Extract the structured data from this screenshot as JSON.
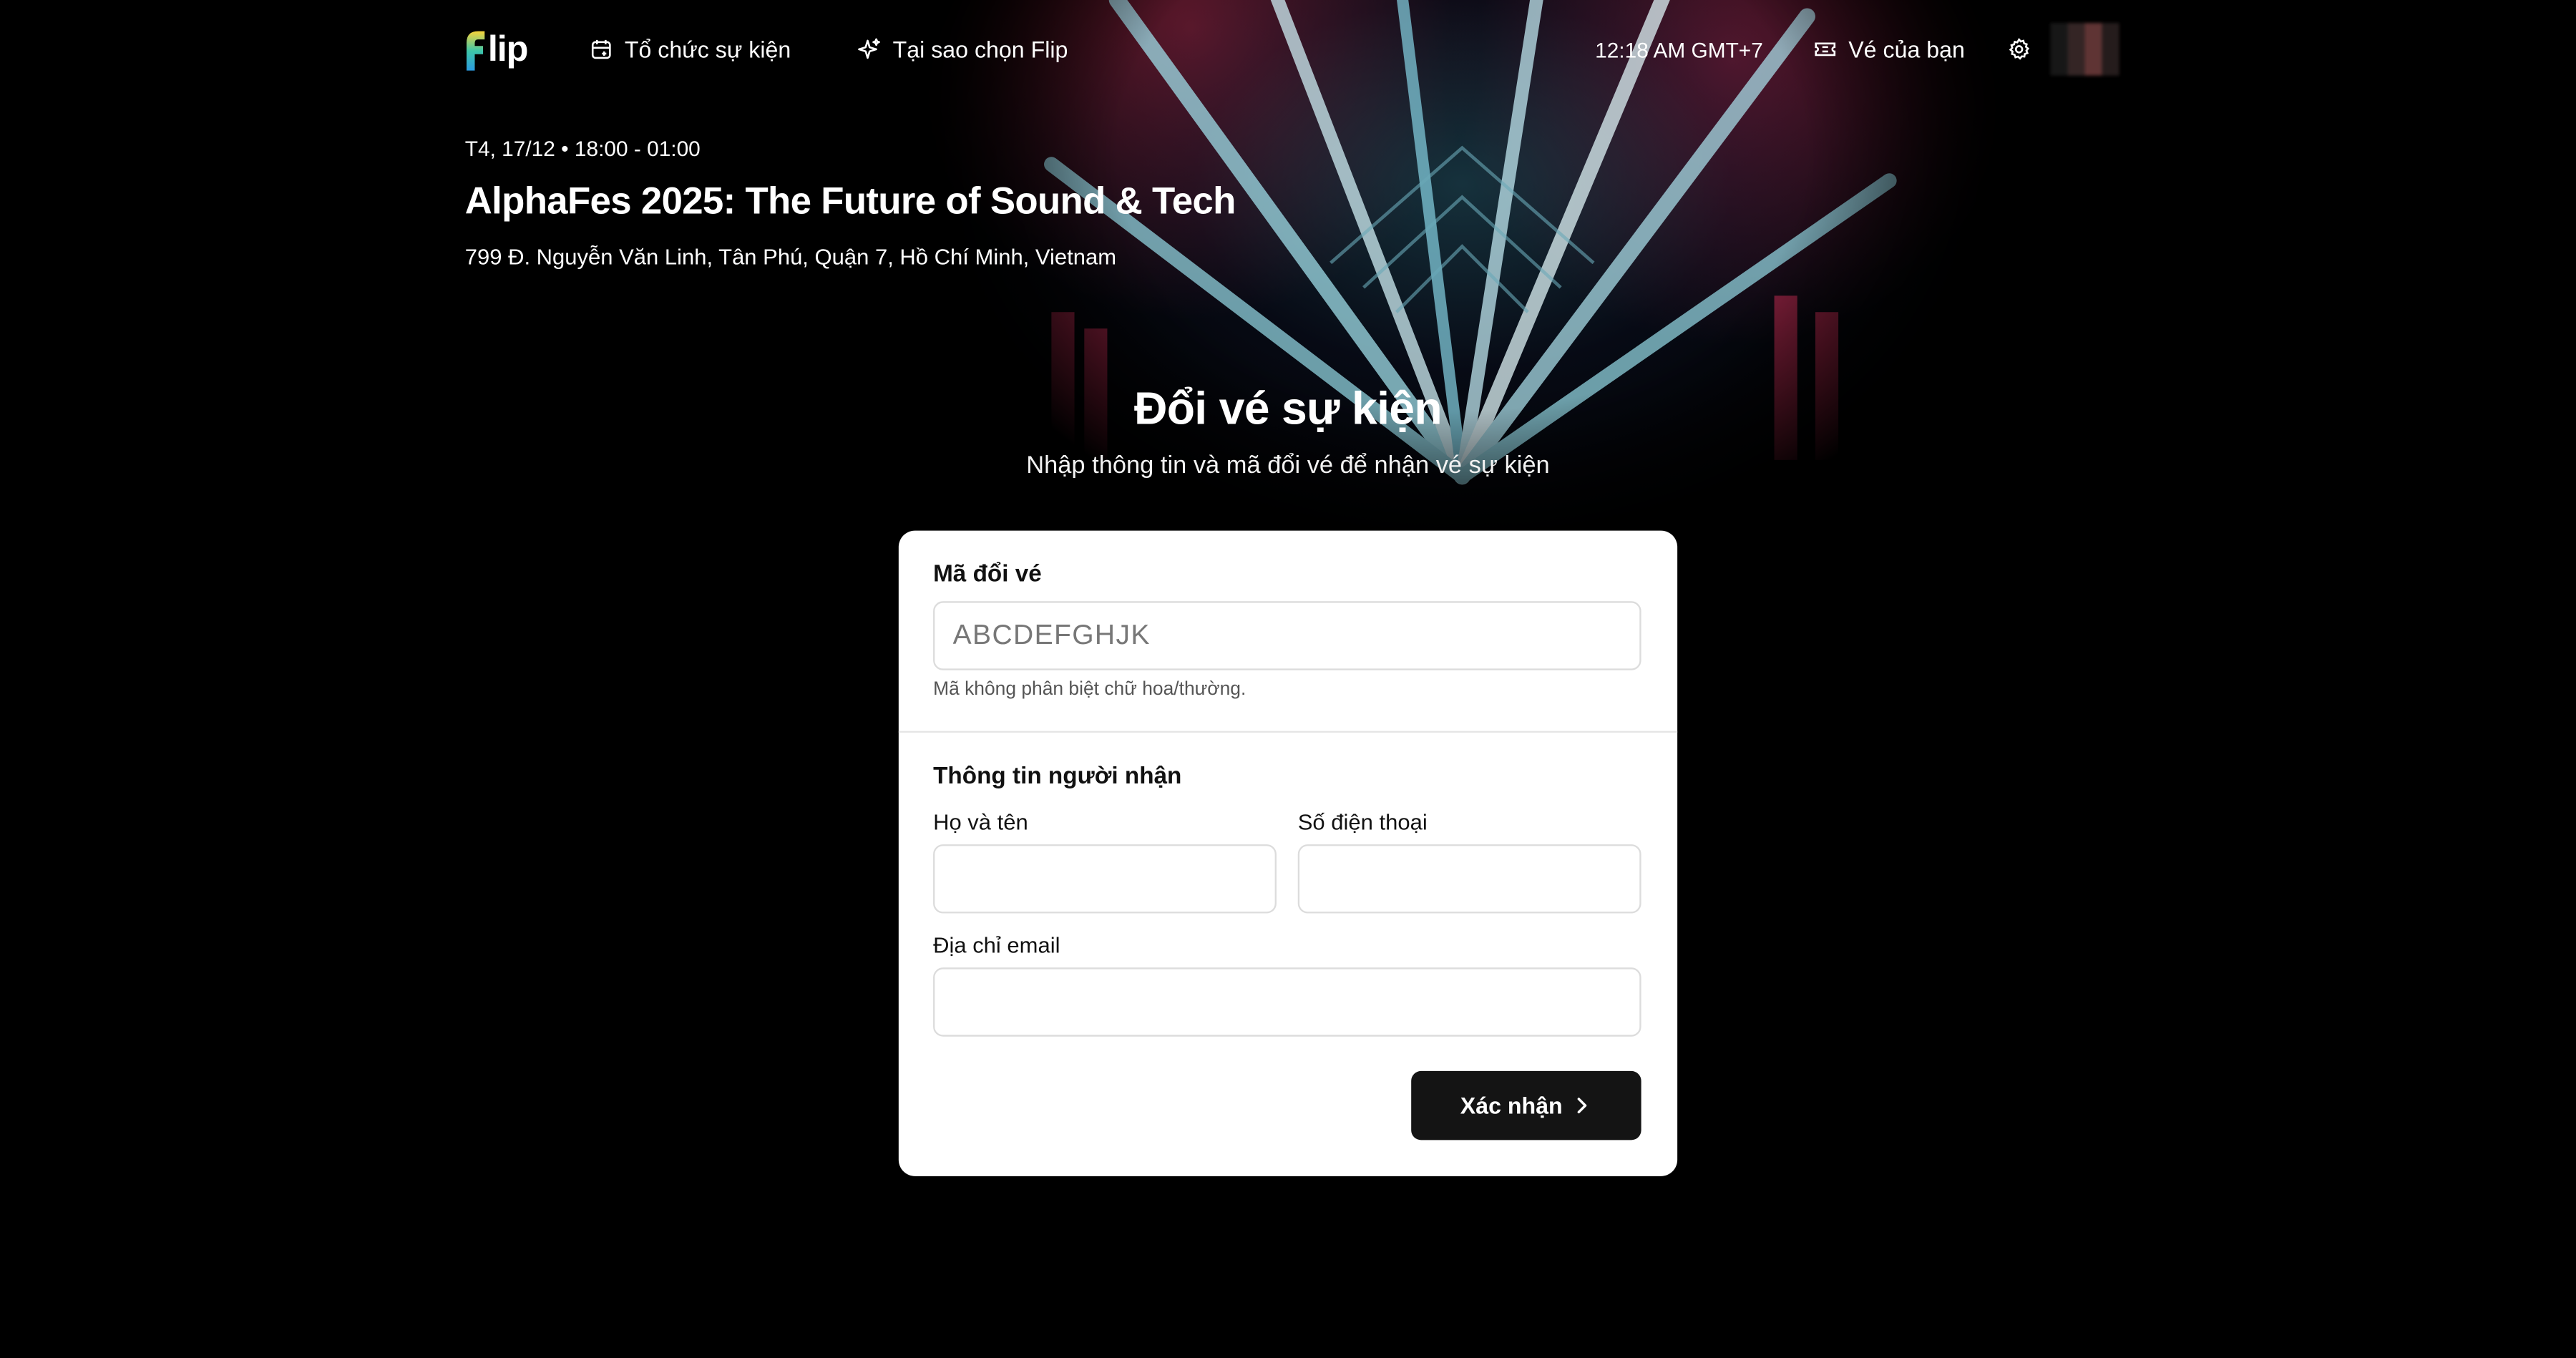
{
  "nav": {
    "logo_text": "lip",
    "links": [
      {
        "label": "Tổ chức sự kiện",
        "icon": "calendar-plus-icon"
      },
      {
        "label": "Tại sao chọn Flip",
        "icon": "sparkles-icon"
      }
    ],
    "time": "12:18 AM GMT+7",
    "tickets_label": "Vé của bạn",
    "tickets_icon": "ticket-icon",
    "settings_icon": "gear-icon"
  },
  "event": {
    "datetime": "T4, 17/12 • 18:00 - 01:00",
    "title": "AlphaFes 2025: The Future of Sound & Tech",
    "address": "799 Đ. Nguyễn Văn Linh, Tân Phú, Quận 7, Hồ Chí Minh, Vietnam"
  },
  "page": {
    "title": "Đổi vé sự kiện",
    "subtitle": "Nhập thông tin và mã đổi vé để nhận vé sự kiện"
  },
  "form": {
    "code_label": "Mã đổi vé",
    "code_placeholder": "ABCDEFGHJK",
    "code_value": "",
    "code_hint": "Mã không phân biệt chữ hoa/thường.",
    "recipient_heading": "Thông tin người nhận",
    "name_label": "Họ và tên",
    "name_value": "",
    "phone_label": "Số điện thoại",
    "phone_value": "",
    "email_label": "Địa chỉ email",
    "email_value": "",
    "submit_label": "Xác nhận",
    "submit_icon": "chevron-right-icon"
  },
  "colors": {
    "background": "#000000",
    "card": "#ffffff",
    "button": "#141414",
    "logo_gradient": [
      "#f7d43a",
      "#3ec6a8",
      "#2b9be0"
    ]
  }
}
